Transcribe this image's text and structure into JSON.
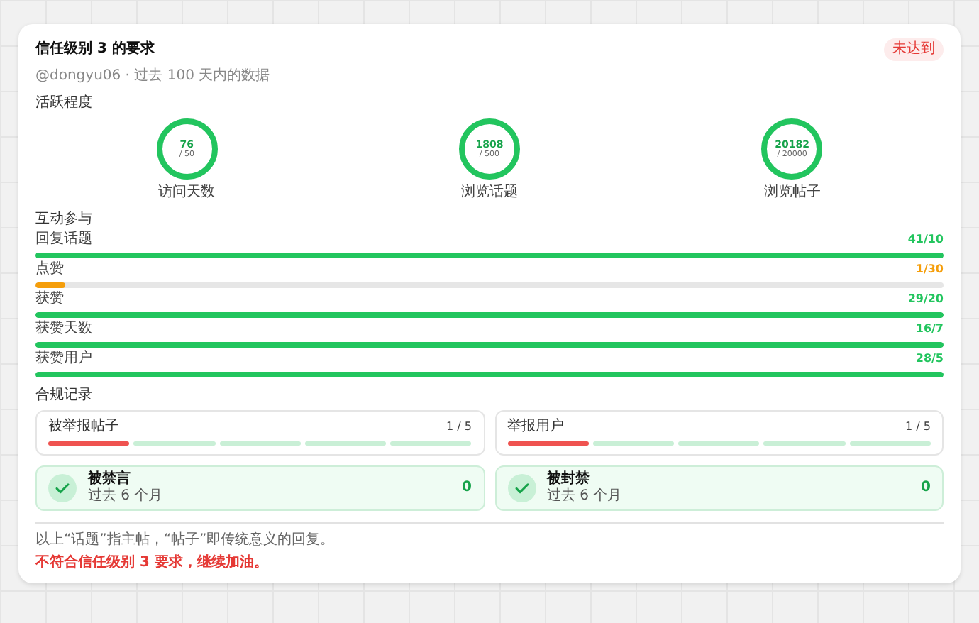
{
  "card": {
    "title": "信任级别 3 的要求",
    "badge": "未达到",
    "subtitle": "@dongyu06 · 过去 100 天内的数据"
  },
  "activity": {
    "heading": "活跃程度",
    "rings": [
      {
        "value": "76",
        "target": "/ 50",
        "label": "访问天数",
        "level": 1
      },
      {
        "value": "1808",
        "target": "/ 500",
        "label": "浏览话题",
        "level": 1
      },
      {
        "value": "20182",
        "target": "/ 20000",
        "label": "浏览帖子",
        "level": 1
      }
    ]
  },
  "engagement": {
    "heading": "互动参与",
    "bars": [
      {
        "label": "回复话题",
        "reading": "41/10",
        "level": 1,
        "color": "#22c55e"
      },
      {
        "label": "点赞",
        "reading": "1/30",
        "level": 0.033,
        "color": "#f59e0b"
      },
      {
        "label": "获赞",
        "reading": "29/20",
        "level": 1,
        "color": "#22c55e"
      },
      {
        "label": "获赞天数",
        "reading": "16/7",
        "level": 1,
        "color": "#22c55e"
      },
      {
        "label": "获赞用户",
        "reading": "28/5",
        "level": 1,
        "color": "#22c55e"
      }
    ]
  },
  "compliance": {
    "heading": "合规记录",
    "reports": [
      {
        "label": "被举报帖子",
        "reading": "1 / 5",
        "segments": [
          {
            "filled": true
          },
          {
            "filled": false
          },
          {
            "filled": false
          },
          {
            "filled": false
          },
          {
            "filled": false
          }
        ]
      },
      {
        "label": "举报用户",
        "reading": "1 / 5",
        "segments": [
          {
            "filled": true
          },
          {
            "filled": false
          },
          {
            "filled": false
          },
          {
            "filled": false
          },
          {
            "filled": false
          }
        ]
      }
    ],
    "statuses": [
      {
        "title": "被禁言",
        "subtitle": "过去 6 个月",
        "count": "0"
      },
      {
        "title": "被封禁",
        "subtitle": "过去 6 个月",
        "count": "0"
      }
    ]
  },
  "footnote": "以上“话题”指主帖，“帖子”即传统意义的回复。",
  "verdict": "不符合信任级别 3 要求，继续加油。"
}
